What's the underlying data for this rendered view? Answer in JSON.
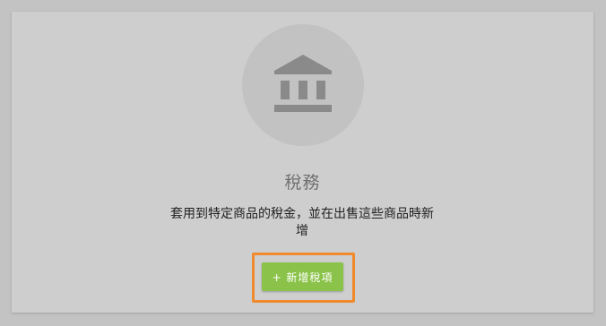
{
  "card": {
    "icon": "bank-icon",
    "title": "稅務",
    "description": "套用到特定商品的稅金，並在出售這些商品時新增",
    "add_button_label": "+ 新增稅項"
  },
  "colors": {
    "button": "#8bc34a",
    "highlight": "#f08a2c",
    "icon": "#8a8a8a"
  }
}
